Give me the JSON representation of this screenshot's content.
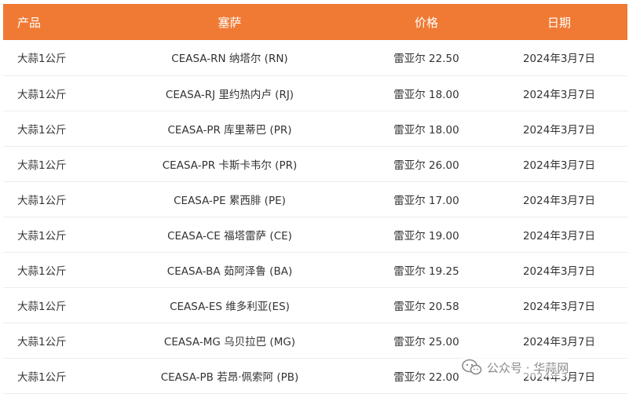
{
  "table": {
    "headers": [
      "产品",
      "塞萨",
      "价格",
      "日期"
    ],
    "rows": [
      [
        "大蒜1公斤",
        "CEASA-RN 纳塔尔 (RN)",
        "雷亚尔 22.50",
        "2024年3月7日"
      ],
      [
        "大蒜1公斤",
        "CEASA-RJ 里约热内卢 (RJ)",
        "雷亚尔 18.00",
        "2024年3月7日"
      ],
      [
        "大蒜1公斤",
        "CEASA-PR 库里蒂巴 (PR)",
        "雷亚尔 18.00",
        "2024年3月7日"
      ],
      [
        "大蒜1公斤",
        "CEASA-PR 卡斯卡韦尔 (PR)",
        "雷亚尔 26.00",
        "2024年3月7日"
      ],
      [
        "大蒜1公斤",
        "CEASA-PE 累西腓 (PE)",
        "雷亚尔 17.00",
        "2024年3月7日"
      ],
      [
        "大蒜1公斤",
        "CEASA-CE 福塔雷萨 (CE)",
        "雷亚尔 19.00",
        "2024年3月7日"
      ],
      [
        "大蒜1公斤",
        "CEASA-BA 茹阿泽鲁 (BA)",
        "雷亚尔 19.25",
        "2024年3月7日"
      ],
      [
        "大蒜1公斤",
        "CEASA-ES 维多利亚(ES)",
        "雷亚尔 20.58",
        "2024年3月7日"
      ],
      [
        "大蒜1公斤",
        "CEASA-MG 乌贝拉巴 (MG)",
        "雷亚尔 25.00",
        "2024年3月7日"
      ],
      [
        "大蒜1公斤",
        "CEASA-PB 若昂·佩索阿 (PB)",
        "雷亚尔 22.00",
        "2024年3月7日"
      ]
    ]
  },
  "watermark": {
    "text": "公众号 · 华蒜网",
    "icon": "wechat-icon"
  },
  "colors": {
    "header_bg": "#f07a34",
    "header_text": "#ffffff",
    "row_divider": "#ececec",
    "body_text": "#333333"
  }
}
